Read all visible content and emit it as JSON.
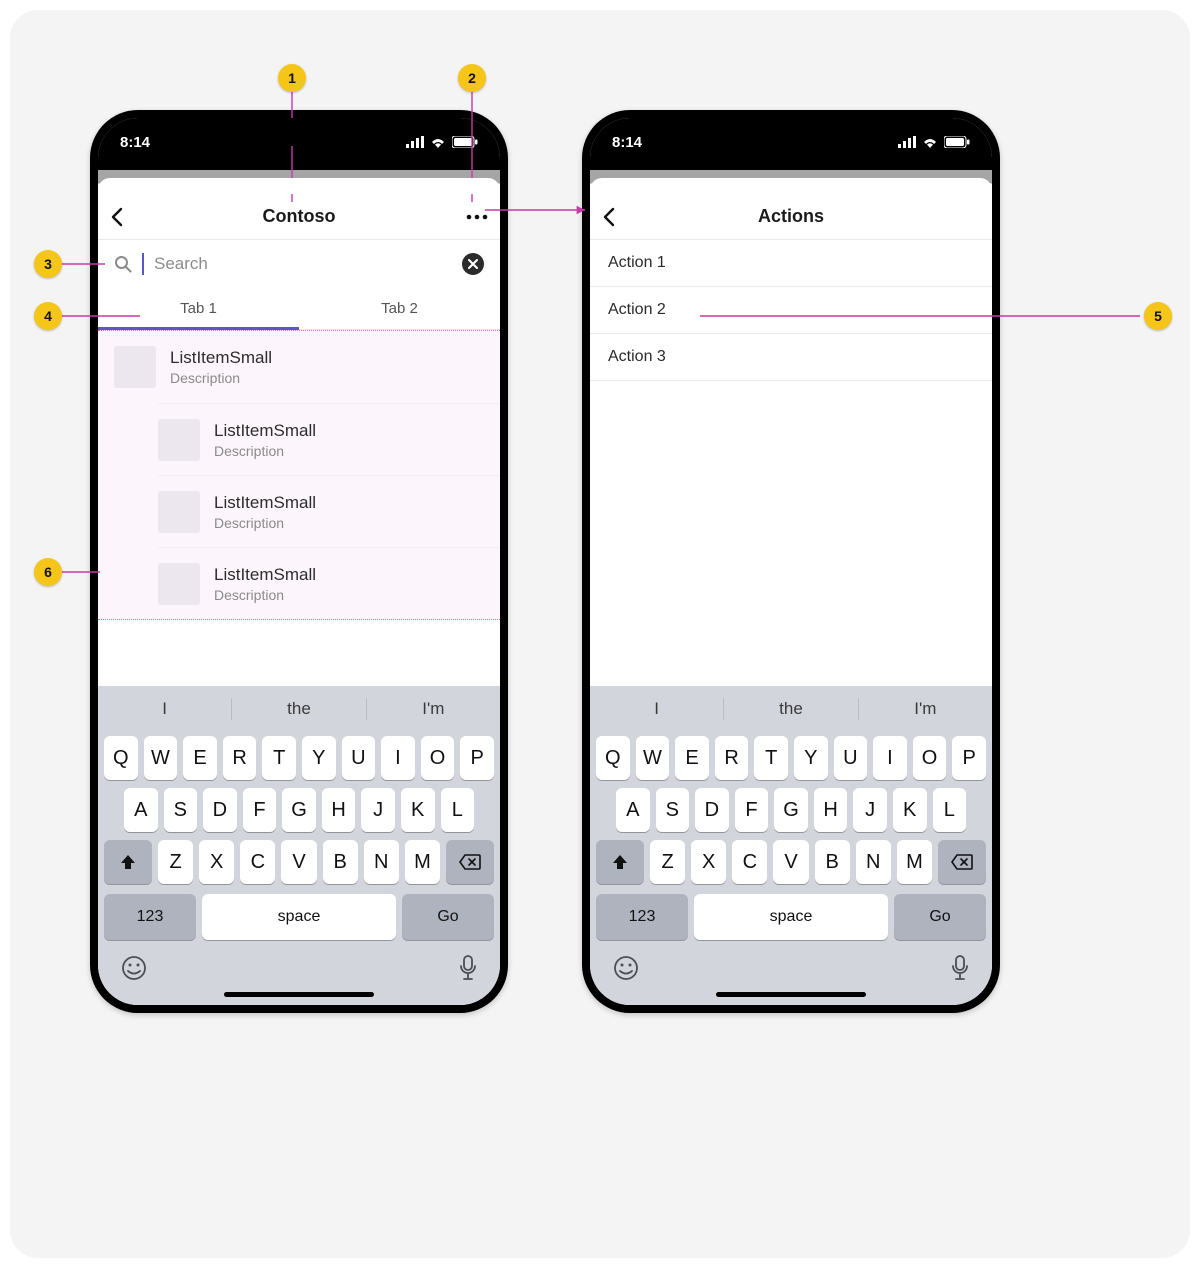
{
  "status": {
    "time": "8:14"
  },
  "screenA": {
    "title": "Contoso",
    "search_placeholder": "Search",
    "tabs": [
      "Tab 1",
      "Tab 2"
    ],
    "list": [
      {
        "title": "ListItemSmall",
        "desc": "Description"
      },
      {
        "title": "ListItemSmall",
        "desc": "Description"
      },
      {
        "title": "ListItemSmall",
        "desc": "Description"
      },
      {
        "title": "ListItemSmall",
        "desc": "Description"
      }
    ]
  },
  "screenB": {
    "title": "Actions",
    "actions": [
      "Action 1",
      "Action 2",
      "Action 3"
    ]
  },
  "keyboard": {
    "suggestions": [
      "I",
      "the",
      "I'm"
    ],
    "row1": [
      "Q",
      "W",
      "E",
      "R",
      "T",
      "Y",
      "U",
      "I",
      "O",
      "P"
    ],
    "row2": [
      "A",
      "S",
      "D",
      "F",
      "G",
      "H",
      "J",
      "K",
      "L"
    ],
    "row3": [
      "Z",
      "X",
      "C",
      "V",
      "B",
      "N",
      "M"
    ],
    "k123": "123",
    "space": "space",
    "go": "Go"
  },
  "callouts": {
    "1": "1",
    "2": "2",
    "3": "3",
    "4": "4",
    "5": "5",
    "6": "6"
  }
}
